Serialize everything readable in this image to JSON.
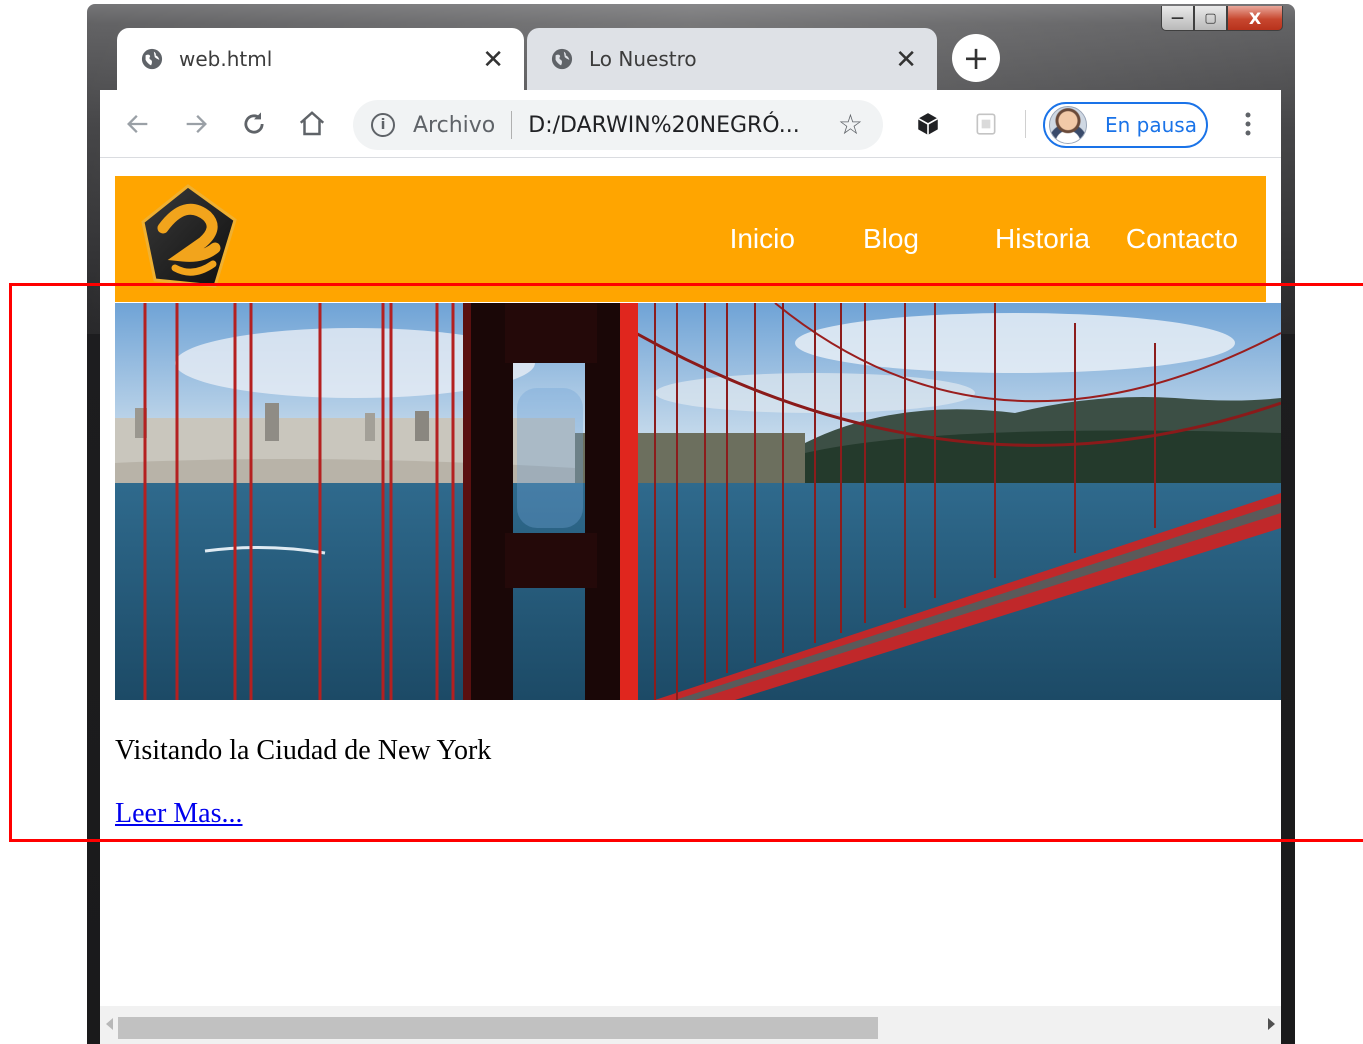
{
  "browser": {
    "tabs": [
      {
        "title": "web.html",
        "active": true
      },
      {
        "title": "Lo Nuestro",
        "active": false
      }
    ],
    "new_tab_label": "+",
    "close_glyph": "✕",
    "address_bar": {
      "scheme_label": "Archivo",
      "url": "D:/DARWIN%20NEGRÓ..."
    },
    "profile_label": "En pausa",
    "icons": {
      "back": "back-arrow-icon",
      "forward": "forward-arrow-icon",
      "reload": "reload-icon",
      "home": "home-icon",
      "info": "info-icon",
      "star": "star-icon",
      "extension": "cube-extension-icon",
      "extension2": "puzzle-extension-icon",
      "menu": "kebab-menu-icon"
    }
  },
  "window_controls": {
    "minimize": "—",
    "maximize": "▢",
    "close": "X"
  },
  "site": {
    "header_color": "#ffa500",
    "nav": [
      {
        "label": "Inicio"
      },
      {
        "label": "Blog"
      },
      {
        "label": "Historia"
      },
      {
        "label": "Contacto"
      }
    ],
    "caption": "Visitando la Ciudad de New York",
    "read_more": "Leer Mas..."
  },
  "colors": {
    "link": "#0000ee",
    "highlight": "#ff0000",
    "profile_accent": "#1a73e8"
  }
}
